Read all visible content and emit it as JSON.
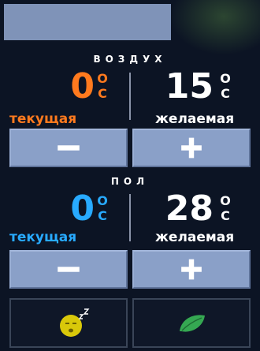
{
  "colors": {
    "orange": "#ff7a1e",
    "blue": "#28aaff",
    "white": "#ffffff",
    "button": "#8aa0c8",
    "status_bar": "#7f93b8"
  },
  "air": {
    "title": "ВОЗДУХ",
    "current": {
      "value": "0",
      "unit_top": "O",
      "unit_bottom": "C",
      "label": "текущая"
    },
    "target": {
      "value": "15",
      "unit_top": "O",
      "unit_bottom": "C",
      "label": "желаемая"
    },
    "decrease_icon": "minus-icon",
    "increase_icon": "plus-icon"
  },
  "floor": {
    "title": "ПОЛ",
    "current": {
      "value": "0",
      "unit_top": "O",
      "unit_bottom": "C",
      "label": "текущая"
    },
    "target": {
      "value": "28",
      "unit_top": "O",
      "unit_bottom": "C",
      "label": "желаемая"
    },
    "decrease_icon": "minus-icon",
    "increase_icon": "plus-icon"
  },
  "modes": {
    "sleep_icon": "sleep-face-icon",
    "eco_icon": "leaf-icon"
  }
}
